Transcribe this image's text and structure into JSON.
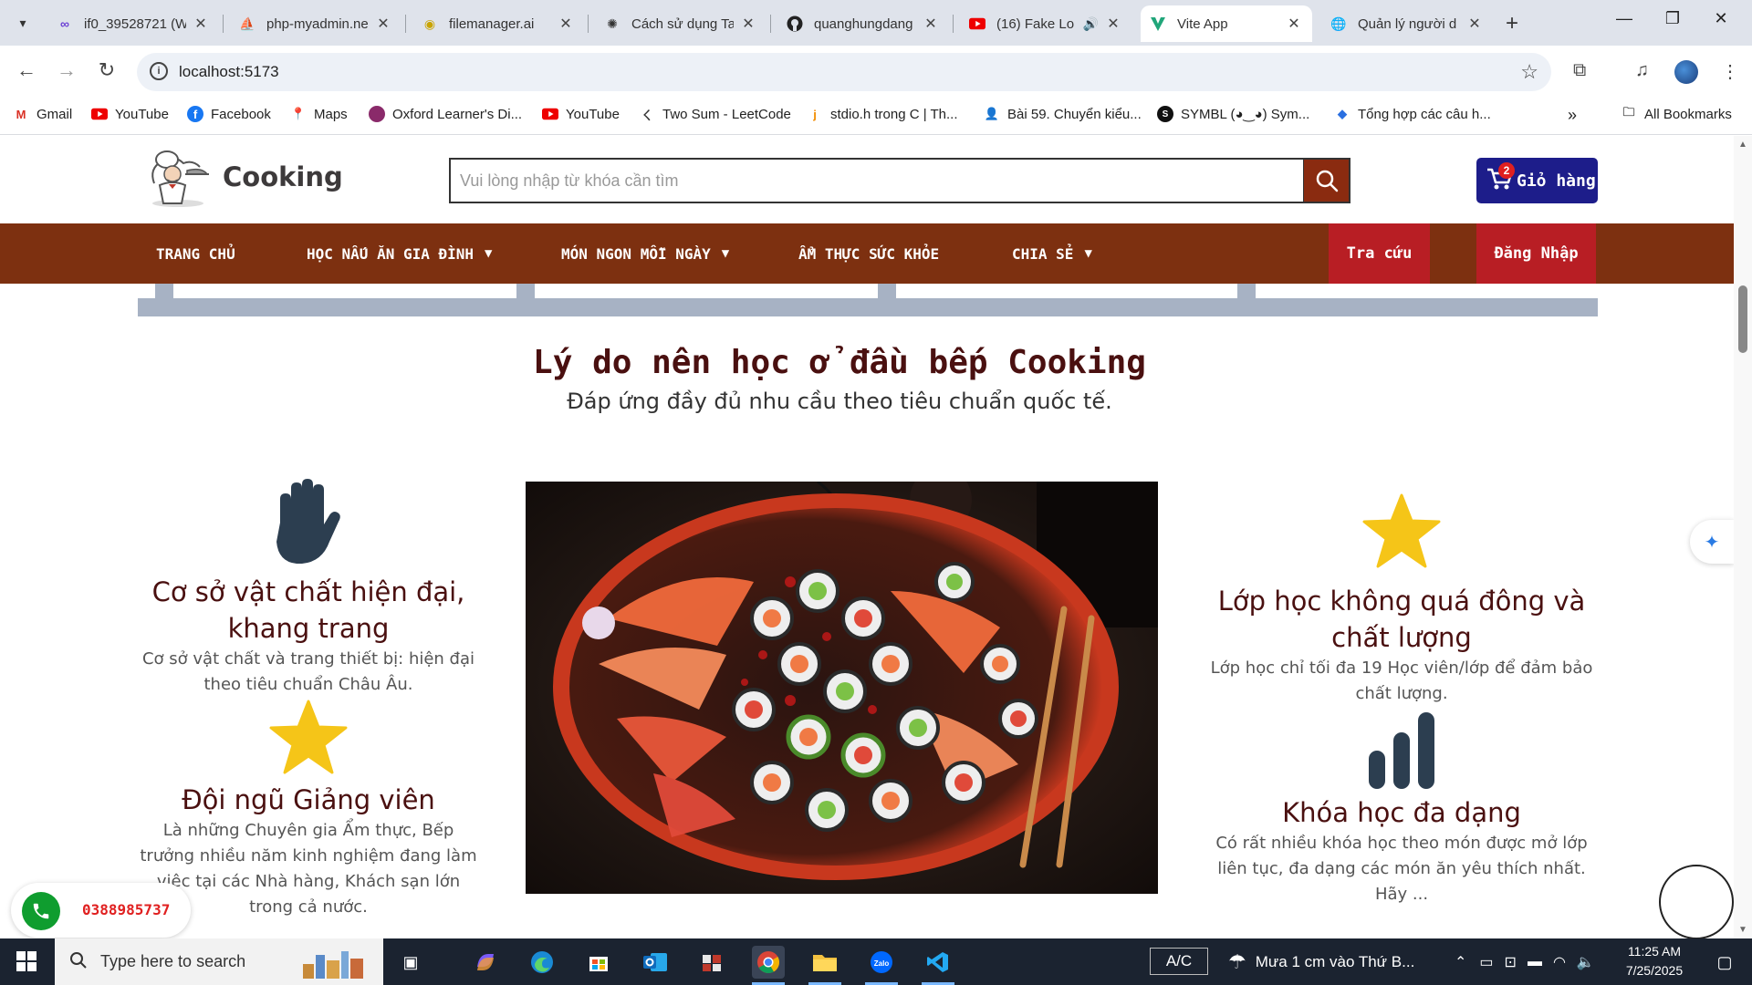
{
  "browser": {
    "tabs": [
      {
        "title": "if0_39528721 (W",
        "icon": "infinity-icon"
      },
      {
        "title": "php-myadmin.ne",
        "icon": "phpmyadmin-icon"
      },
      {
        "title": "filemanager.ai",
        "icon": "filemanager-icon"
      },
      {
        "title": "Cách sử dụng Ta",
        "icon": "openai-icon"
      },
      {
        "title": "quanghungdang",
        "icon": "github-icon"
      },
      {
        "title": "(16) Fake Lo",
        "icon": "youtube-icon"
      },
      {
        "title": "Vite App",
        "icon": "vite-icon",
        "active": true
      },
      {
        "title": "Quản lý người d",
        "icon": "globe-icon"
      }
    ],
    "url": "localhost:5173",
    "bookmarks": [
      {
        "label": "Gmail",
        "icon": "gmail-icon"
      },
      {
        "label": "YouTube",
        "icon": "youtube-icon"
      },
      {
        "label": "Facebook",
        "icon": "facebook-icon"
      },
      {
        "label": "Maps",
        "icon": "maps-icon"
      },
      {
        "label": "Oxford Learner's Di...",
        "icon": "oxford-icon"
      },
      {
        "label": "YouTube",
        "icon": "youtube-icon"
      },
      {
        "label": "Two Sum - LeetCode",
        "icon": "leetcode-icon"
      },
      {
        "label": "stdio.h trong C | Th...",
        "icon": "j-icon"
      },
      {
        "label": "Bài 59. Chuyển kiểu...",
        "icon": "person-icon"
      },
      {
        "label": "SYMBL (◕‿◕) Sym...",
        "icon": "symbl-icon"
      },
      {
        "label": "Tổng hợp các câu h...",
        "icon": "diamond-icon"
      }
    ],
    "all_bookmarks": "All Bookmarks"
  },
  "site": {
    "logo_text": "Cooking",
    "search_placeholder": "Vui lòng nhập từ khóa cần tìm",
    "cart_label": "Giỏ hàng",
    "cart_count": "2",
    "menu": [
      {
        "label": "TRANG CHỦ",
        "dropdown": false
      },
      {
        "label": "HỌC NẤU ĂN GIA ĐÌNH",
        "dropdown": true
      },
      {
        "label": "MÓN NGON MỖI NGÀY",
        "dropdown": true
      },
      {
        "label": "ẨM THỰC SỨC KHỎE",
        "dropdown": false
      },
      {
        "label": "CHIA SẺ",
        "dropdown": true
      }
    ],
    "lookup_label": "Tra cứu",
    "login_label": "Đăng Nhập",
    "colors": {
      "menu_bg": "#7d3010",
      "red_button": "#b81e24",
      "cart_bg": "#1d1d8a",
      "heading": "#4a1010",
      "star": "#f5c518",
      "icon_dark": "#2c3e50"
    }
  },
  "section": {
    "title": "Lý do nên học ở đầu bếp Cooking",
    "subtitle": "Đáp ứng đầy đủ nhu cầu theo tiêu chuẩn quốc tế.",
    "features": [
      {
        "icon": "hand-icon",
        "title": "Cơ sở vật chất hiện đại, khang trang",
        "text": "Cơ sở vật chất và trang thiết bị: hiện đại theo tiêu chuẩn Châu Âu."
      },
      {
        "icon": "star-icon",
        "title": "Đội ngũ Giảng viên",
        "text": "Là những Chuyên gia Ẩm thực, Bếp trưởng nhiều năm kinh nghiệm đang làm việc tại các Nhà hàng, Khách sạn lớn trong cả nước."
      },
      {
        "icon": "star-icon",
        "title": "Lớp học không quá đông và chất lượng",
        "text": "Lớp học chỉ tối đa 19 Học viên/lớp để đảm bảo chất lượng."
      },
      {
        "icon": "bar-chart-icon",
        "title": "Khóa học đa dạng",
        "text": "Có rất nhiều khóa học theo món được mở lớp liên tục, đa dạng các món ăn yêu thích nhất. Hãy ..."
      }
    ]
  },
  "floating": {
    "phone": "0388985737"
  },
  "taskbar": {
    "search_placeholder": "Type here to search",
    "ac_label": "A/C",
    "weather": "Mưa 1 cm vào Thứ B...",
    "time": "11:25 AM",
    "date": "7/25/2025"
  }
}
